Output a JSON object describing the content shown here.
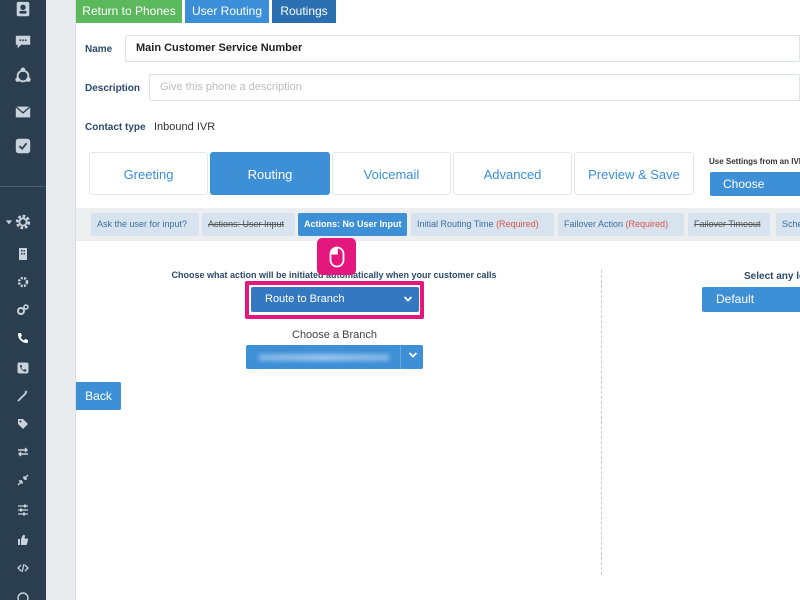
{
  "top_tabs": {
    "return_to_phones": "Return to Phones",
    "user_routing": "User Routing",
    "routings": "Routings"
  },
  "form": {
    "name_label": "Name",
    "name_value": "Main Customer Service Number",
    "description_label": "Description",
    "description_placeholder": "Give this phone a description",
    "contact_type_label": "Contact type",
    "contact_type_value": "Inbound IVR"
  },
  "section_tabs": [
    "Greeting",
    "Routing",
    "Voicemail",
    "Advanced",
    "Preview & Save"
  ],
  "ivr_settings": {
    "label": "Use Settings from an IVR",
    "choose_value": "Choose"
  },
  "sub_tabs": {
    "ask_user": "Ask the user for input?",
    "actions_user_input": "Actions: User Input",
    "actions_no_user_input": "Actions: No User Input",
    "initial_routing_time": "Initial Routing Time",
    "failover_action": "Failover Action",
    "required": "(Required)",
    "failover_timeout": "Failover Timeout",
    "schedule_partial": "Sche"
  },
  "routing": {
    "action_label": "Choose what action will be initiated automatically when your customer calls",
    "action_value": "Route to Branch",
    "branch_label": "Choose a Branch",
    "back_label": "Back",
    "select_any_label": "Select any le",
    "default_value": "Default"
  },
  "colors": {
    "nav_bg": "#2b3e50",
    "accent_blue": "#3d8fd6",
    "green": "#5cb85c",
    "highlight_pink": "#e4177e",
    "required_red": "#d9534f"
  }
}
